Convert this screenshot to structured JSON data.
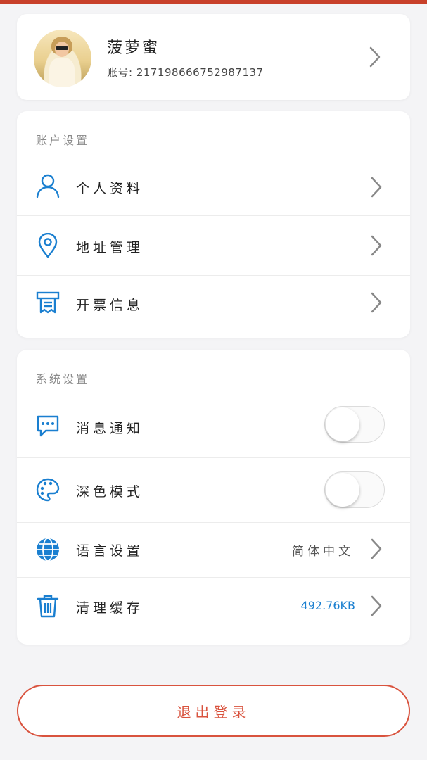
{
  "profile": {
    "name": "菠萝蜜",
    "account": "账号: 21719866675298713 7",
    "account_text": "账号: 217198666752987137"
  },
  "account_settings": {
    "title": "账户设置",
    "items": [
      {
        "label": "个人资料",
        "icon": "person-icon"
      },
      {
        "label": "地址管理",
        "icon": "location-pin-icon"
      },
      {
        "label": "开票信息",
        "icon": "invoice-icon"
      }
    ]
  },
  "system_settings": {
    "title": "系统设置",
    "items": [
      {
        "label": "消息通知",
        "icon": "message-bubble-icon",
        "toggle": false
      },
      {
        "label": "深色模式",
        "icon": "palette-icon",
        "toggle": false
      },
      {
        "label": "语言设置",
        "icon": "globe-icon",
        "value": "简体中文"
      },
      {
        "label": "清理缓存",
        "icon": "trash-icon",
        "value": "492.76KB"
      }
    ]
  },
  "logout_label": "退出登录",
  "colors": {
    "accent_blue": "#1a7fd0",
    "logout_red": "#d9533e",
    "top_bar": "#c8402a"
  }
}
